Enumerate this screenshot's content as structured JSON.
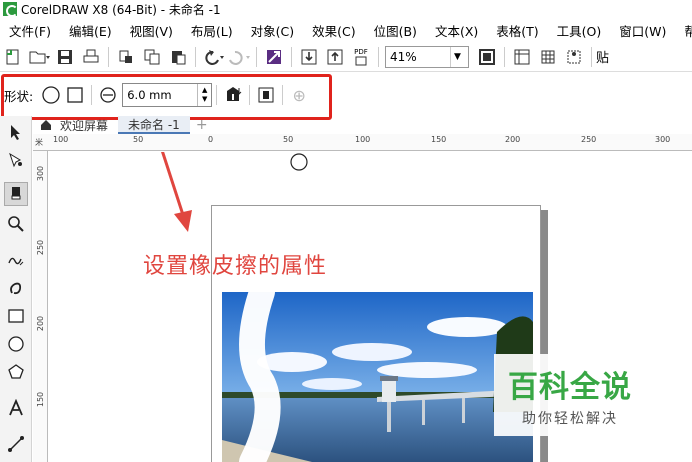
{
  "window": {
    "title": "CorelDRAW X8 (64-Bit) - 未命名 -1"
  },
  "menu": [
    "文件(F)",
    "编辑(E)",
    "视图(V)",
    "布局(L)",
    "对象(C)",
    "效果(C)",
    "位图(B)",
    "文本(X)",
    "表格(T)",
    "工具(O)",
    "窗口(W)",
    "帮助("
  ],
  "toolbar": {
    "zoom": "41%",
    "pdf_label": "PDF",
    "overflow_char": "贴",
    "icons": [
      "new-document-icon",
      "open-folder-icon",
      "save-icon",
      "print-icon",
      "cut-icon",
      "copy-icon",
      "paste-icon",
      "undo-icon",
      "redo-icon",
      "corel-connect-icon",
      "import-icon",
      "export-icon",
      "publish-pdf-icon",
      "full-screen-icon",
      "show-rulers-icon",
      "show-grid-icon",
      "show-guides-icon"
    ]
  },
  "property_bar": {
    "shape_label": "形状:",
    "eraser_size": "6.0 mm"
  },
  "tabs": [
    {
      "label": "欢迎屏幕"
    },
    {
      "label": "未命名 -1"
    }
  ],
  "ruler": {
    "unit_glyph": "米",
    "h_ticks": [
      "100",
      "50",
      "0",
      "50",
      "100",
      "150",
      "200",
      "250",
      "300"
    ],
    "v_ticks": [
      "300",
      "250",
      "200",
      "150"
    ]
  },
  "annotation": "设置橡皮擦的属性",
  "watermark": {
    "title": "百科全说",
    "subtitle": "助你轻松解决"
  },
  "colors": {
    "highlight": "#e0231c",
    "annotation": "#e0463f",
    "watermark_green": "#38a745",
    "tab_accent": "#4a78b5"
  }
}
